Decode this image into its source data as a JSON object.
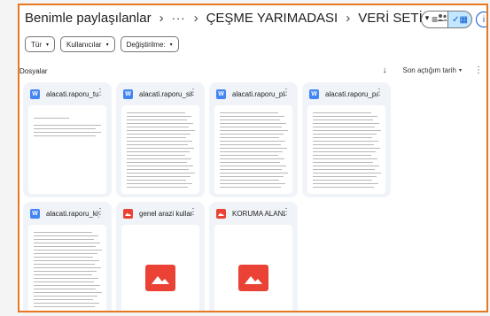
{
  "breadcrumb": {
    "root": "Benimle paylaşılanlar",
    "sep": "›",
    "overflow": "···",
    "folder": "ÇEŞME YARIMADASI",
    "current": "VERİ SETİ",
    "caret": "▾"
  },
  "view": {
    "list_glyph": "≡",
    "grid_glyph": "✓▦",
    "info_glyph": "i"
  },
  "filters": [
    {
      "label": "Tür",
      "caret": "▾"
    },
    {
      "label": "Kullanıcılar",
      "caret": "▾"
    },
    {
      "label": "Değiştirilme:",
      "caret": "▾"
    }
  ],
  "section_title": "Dosyalar",
  "sort": {
    "arrow": "↓",
    "label": "Son açtığım tarih",
    "caret": "▾",
    "more": "⋮"
  },
  "files": [
    {
      "name": "alacati.raporu_turi...",
      "type": "doc",
      "icon": "docs-icon",
      "kebab": "⋮",
      "doc_icon_letter": "W"
    },
    {
      "name": "alacati.raporu_sit....",
      "type": "doc",
      "icon": "docs-icon",
      "kebab": "⋮",
      "doc_icon_letter": "W"
    },
    {
      "name": "alacati.raporu_pla...",
      "type": "doc",
      "icon": "docs-icon",
      "kebab": "⋮",
      "doc_icon_letter": "W"
    },
    {
      "name": "alacati.raporu_par...",
      "type": "doc",
      "icon": "docs-icon",
      "kebab": "⋮",
      "doc_icon_letter": "W"
    },
    {
      "name": "alacati.raporu_kiyi....",
      "type": "doc",
      "icon": "docs-icon",
      "kebab": "⋮",
      "doc_icon_letter": "W"
    },
    {
      "name": "genel arazi kullanı...",
      "type": "image",
      "icon": "image-file-icon",
      "kebab": "⋮"
    },
    {
      "name": "KORUMA ALANLA...",
      "type": "image",
      "icon": "image-file-icon",
      "kebab": "⋮"
    }
  ],
  "colors": {
    "accent_border": "#e87722",
    "doc_icon": "#4285f4",
    "image_icon": "#ea4335",
    "card_bg": "#f0f4f9"
  }
}
